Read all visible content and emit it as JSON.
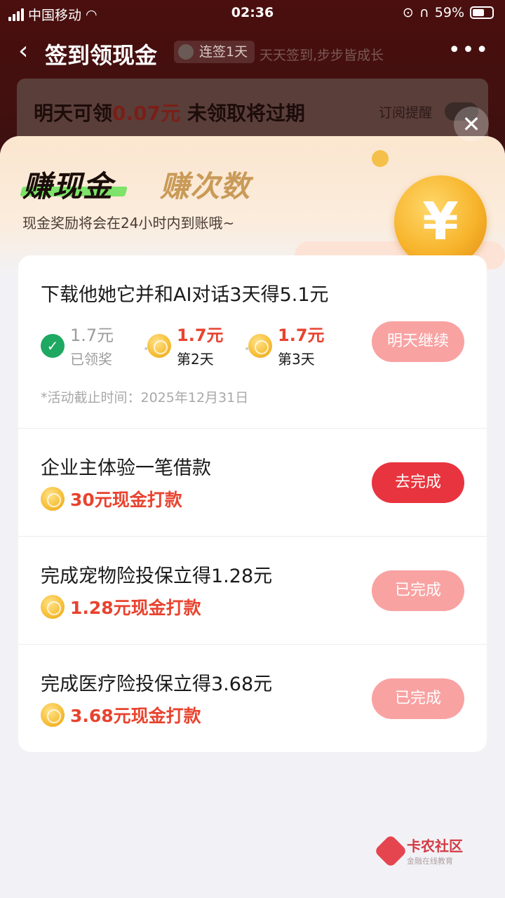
{
  "status_bar": {
    "carrier": "中国移动",
    "time": "02:36",
    "battery": "59%"
  },
  "header": {
    "title": "签到领现金",
    "streak_badge": "连签1天",
    "slogan": "天天签到,步步皆成长"
  },
  "notice": {
    "prefix": "明天可领",
    "amount": "0.07元",
    "suffix": " 未领取将过期",
    "remind_label": "订阅提醒"
  },
  "sheet": {
    "tabs": [
      {
        "label": "赚现金"
      },
      {
        "label": "赚次数"
      }
    ],
    "subtitle": "现金奖励将会在24小时内到账哦~",
    "coin_symbol": "¥"
  },
  "tasks": [
    {
      "title": "下载他她它并和AI对话3天得5.1元",
      "steps": [
        {
          "value": "1.7元",
          "label": "已领奖",
          "status": "done"
        },
        {
          "value": "1.7元",
          "label": "第2天",
          "status": "pending"
        },
        {
          "value": "1.7元",
          "label": "第3天",
          "status": "pending"
        }
      ],
      "deadline": "*活动截止时间：2025年12月31日",
      "button": "明天继续"
    },
    {
      "title": "企业主体验一笔借款",
      "reward": "30元现金打款",
      "button": "去完成"
    },
    {
      "title": "完成宠物险投保立得1.28元",
      "reward": "1.28元现金打款",
      "button": "已完成"
    },
    {
      "title": "完成医疗险投保立得3.68元",
      "reward": "3.68元现金打款",
      "button": "已完成"
    }
  ],
  "watermark": {
    "name": "卡农社区",
    "tagline": "金融在线教育"
  },
  "colors": {
    "accent_red": "#e8343e",
    "reward_red": "#e8432f",
    "button_disabled": "#f9a2a2",
    "check_green": "#1ea861"
  }
}
